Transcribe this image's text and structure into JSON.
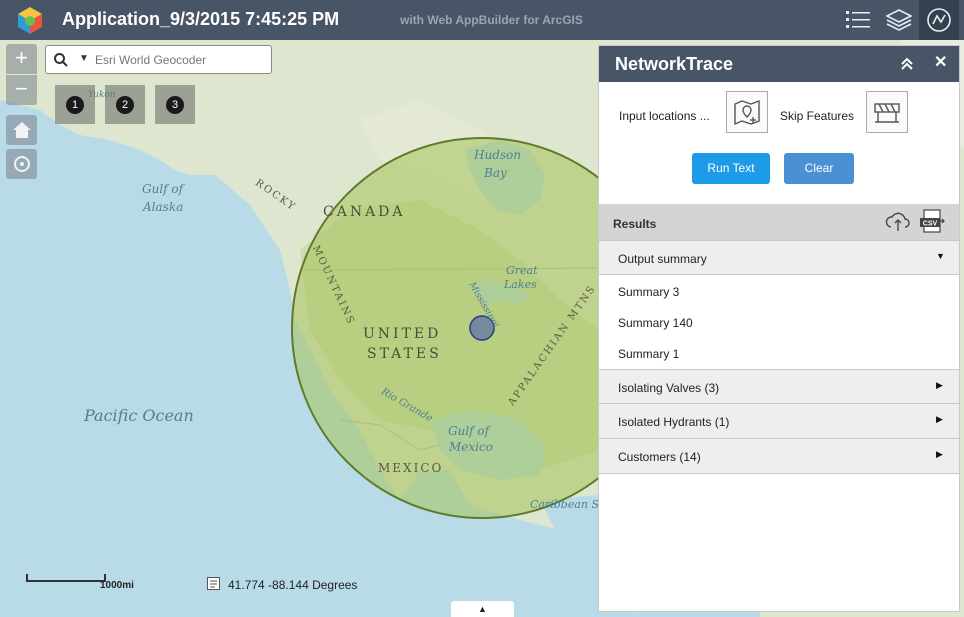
{
  "header": {
    "title": "Application_9/3/2015 7:45:25 PM",
    "subtitle": "with Web AppBuilder for ArcGIS"
  },
  "search": {
    "placeholder": "Esri World Geocoder"
  },
  "bookmarks": [
    "1",
    "2",
    "3"
  ],
  "map": {
    "labels": {
      "hudson": "Hudson",
      "bay": "Bay",
      "gulf_alaska_1": "Gulf of",
      "gulf_alaska_2": "Alaska",
      "rocky": "ROCKY",
      "mountains": "MOUNTAINS",
      "canada": "CANADA",
      "united": "UNITED",
      "states": "STATES",
      "great": "Great",
      "lakes": "Lakes",
      "appalachian": "APPALACHIAN MTNS",
      "pacific": "Pacific Ocean",
      "rio_grande": "Rio Grande",
      "gulf_mexico_1": "Gulf of",
      "gulf_mexico_2": "Mexico",
      "mexico": "MEXICO",
      "caribbean": "Caribbean S",
      "yukon": "Yukon",
      "mississippi": "Mississippi"
    },
    "scale_label": "1000mi",
    "coordinates": "41.774 -88.144 Degrees",
    "buffer_color": "#a6c35a",
    "point_color": "#4a5bb0"
  },
  "panel": {
    "title": "NetworkTrace",
    "input_locations_label": "Input locations ...",
    "skip_features_label": "Skip Features",
    "run_button": "Run Text",
    "clear_button": "Clear",
    "results_label": "Results",
    "sections": {
      "output_summary": "Output summary",
      "summary_items": [
        "Summary 3",
        "Summary 140",
        "Summary 1"
      ],
      "isolating_valves": "Isolating Valves (3)",
      "isolated_hydrants": "Isolated Hydrants (1)",
      "customers": "Customers (14)"
    }
  },
  "icons": {
    "collapse": "double-chevron-up-icon",
    "close": "close-icon",
    "upload": "cloud-upload-icon",
    "csv": "csv-export-icon"
  }
}
